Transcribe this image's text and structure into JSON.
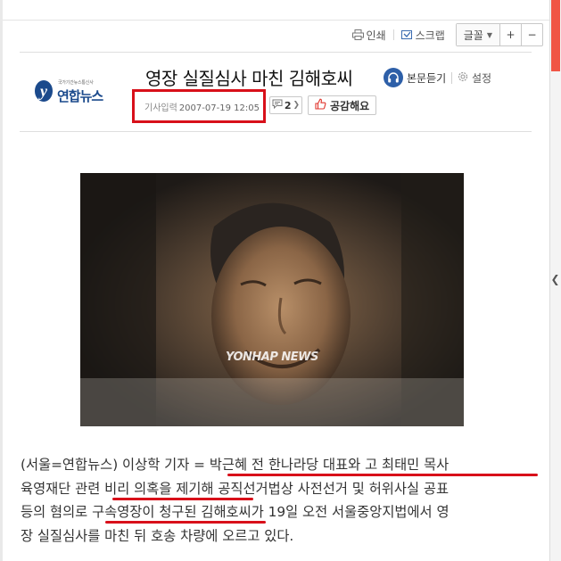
{
  "toolbar": {
    "print_label": "인쇄",
    "scrap_label": "스크랩",
    "font_label": "글꼴",
    "font_increase": "+",
    "font_decrease": "−"
  },
  "publisher": {
    "small_text": "국가기간뉴스통신사",
    "name": "연합뉴스",
    "brand_color": "#1b4a8c"
  },
  "article": {
    "title": "영장 실질심사 마친 김해호씨",
    "listen_label": "본문듣기",
    "settings_label": "설정",
    "date_label": "기사입력",
    "date_value": "2007-07-19 12:05",
    "comment_count": "2",
    "like_label": "공감해요",
    "photo_watermark": "YONHAP NEWS",
    "body_lines": [
      "(서울=연합뉴스) 이상학 기자 = 박근혜 전 한나라당 대표와 고 최태민 목사",
      "육영재단 관련 비리 의혹을 제기해 공직선거법상 사전선거 및 허위사실 공표",
      "등의 혐의로 구속영장이 청구된 김해호씨가 19일 오전 서울중앙지법에서 영",
      "장 실질심사를 마친 뒤 호송 차량에 오르고 있다."
    ]
  },
  "colors": {
    "highlight_red": "#d8101a",
    "scrollbar_accent": "#f05545"
  },
  "icons": [
    "printer-icon",
    "scrap-icon",
    "headphone-icon",
    "gear-icon",
    "comment-icon",
    "thumbs-up-icon",
    "chevron-left-icon"
  ]
}
